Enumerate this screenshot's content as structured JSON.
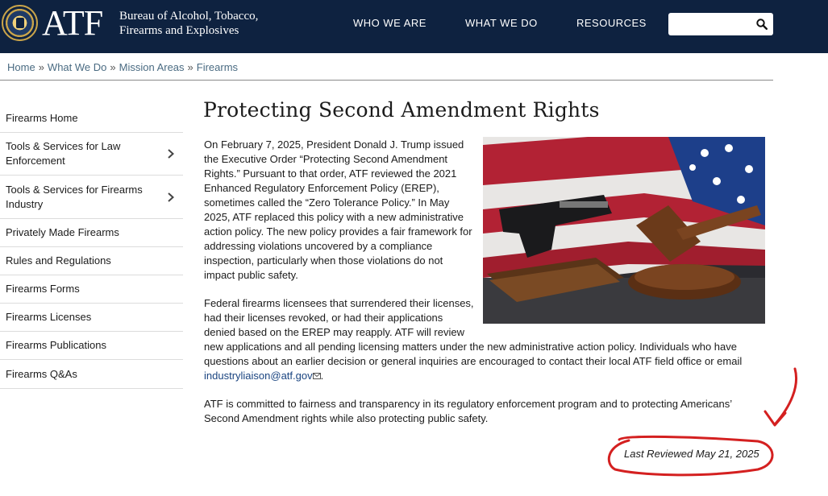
{
  "header": {
    "logo": "ATF",
    "bureau_line1": "Bureau of Alcohol, Tobacco,",
    "bureau_line2": "Firearms and Explosives",
    "nav": [
      "WHO WE ARE",
      "WHAT WE DO",
      "RESOURCES"
    ],
    "search_placeholder": "",
    "colors": {
      "background": "#0e2240",
      "text": "#ffffff"
    }
  },
  "breadcrumb": {
    "items": [
      "Home",
      "What We Do",
      "Mission Areas",
      "Firearms"
    ],
    "separator": "»"
  },
  "sidebar": {
    "items": [
      {
        "label": "Firearms Home",
        "has_submenu": false
      },
      {
        "label": "Tools & Services for Law Enforcement",
        "has_submenu": true
      },
      {
        "label": "Tools & Services for Firearms Industry",
        "has_submenu": true
      },
      {
        "label": "Privately Made Firearms",
        "has_submenu": false
      },
      {
        "label": "Rules and Regulations",
        "has_submenu": false
      },
      {
        "label": "Firearms Forms",
        "has_submenu": false
      },
      {
        "label": "Firearms Licenses",
        "has_submenu": false
      },
      {
        "label": "Firearms Publications",
        "has_submenu": false
      },
      {
        "label": "Firearms Q&As",
        "has_submenu": false
      }
    ]
  },
  "main": {
    "title": "Protecting Second Amendment Rights",
    "paragraph1": "On February 7, 2025, President Donald J. Trump issued the Executive Order “Protecting Second Amendment Rights.”  Pursuant to that order, ATF reviewed the 2021 Enhanced Regulatory Enforcement Policy (EREP), sometimes called the “Zero Tolerance Policy.”  In May 2025, ATF replaced this policy with a new administrative action policy.  The new policy provides a fair framework for addressing violations uncovered by a compliance inspection, particularly when those violations do not impact public safety.",
    "paragraph2": "Federal firearms licensees that surrendered their licenses, had their licenses revoked, or had their applications denied based on the EREP may reapply.  ATF will review new applications and all pending licensing matters under the new administrative action policy.  Individuals who have questions about an earlier decision or general inquiries are encouraged to contact their local ATF field office or email",
    "email": "industryliaison@atf.gov",
    "paragraph2_end": ".",
    "paragraph3": "ATF is committed to fairness and transparency in its regulatory enforcement program and to protecting Americans’ Second Amendment rights while also protecting public safety.",
    "last_reviewed": "Last Reviewed May 21, 2025",
    "image_subject": "handgun-gavel-book-flag-photo"
  },
  "annotation": {
    "color": "#d42020"
  }
}
